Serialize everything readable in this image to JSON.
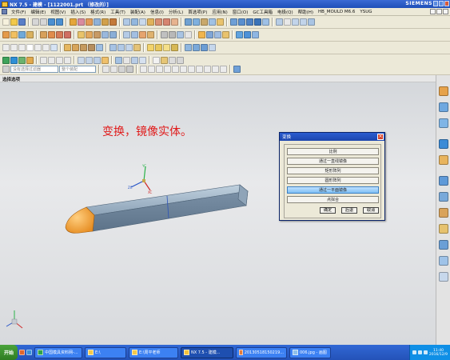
{
  "window": {
    "title": "NX 7.5 - 建模 - [1122001.prt （修改的）]",
    "brand": "SIEMENS"
  },
  "menu": [
    "文件(F)",
    "编辑(E)",
    "视图(V)",
    "插入(S)",
    "格式(R)",
    "工具(T)",
    "装配(A)",
    "信息(I)",
    "分析(L)",
    "首选项(P)",
    "应用(N)",
    "窗口(O)",
    "GC工具箱",
    "电极(Q)",
    "帮助(H)",
    "HB_MOULD M6.6",
    "YSUG"
  ],
  "toolbar": {
    "filter_placeholder": "没有选择过滤器",
    "assembly_select": "整个装配"
  },
  "viewport": {
    "header": "选择选项",
    "caption": "变换，镜像实体。"
  },
  "dialog": {
    "title": "变换",
    "options": [
      "比例",
      "通过一直线镜像",
      "矩形阵列",
      "圆形阵列",
      "通过一平面镜像",
      "点拟合"
    ],
    "active_option_index": 4,
    "ok": "确定",
    "back": "后退",
    "cancel": "取消"
  },
  "taskbar": {
    "start": "开始",
    "tasks": [
      {
        "label": "中国模具资料网-...",
        "active": false
      },
      {
        "label": "E:\\",
        "active": false
      },
      {
        "label": "E:\\周平老师",
        "active": false
      },
      {
        "label": "NX 7.5 - 建模...",
        "active": true
      },
      {
        "label": "20130518150219...",
        "active": false
      },
      {
        "label": "006.jpg - 画图",
        "active": false
      }
    ],
    "clock_time": "11:40",
    "clock_date": "2016/12/9"
  },
  "colors": {
    "caption": "#e01b1b",
    "title_bar": "#1f4fb8",
    "taskbar": "#2452b8",
    "part_body": "#8aa0b4",
    "part_end": "#f0a13a"
  }
}
